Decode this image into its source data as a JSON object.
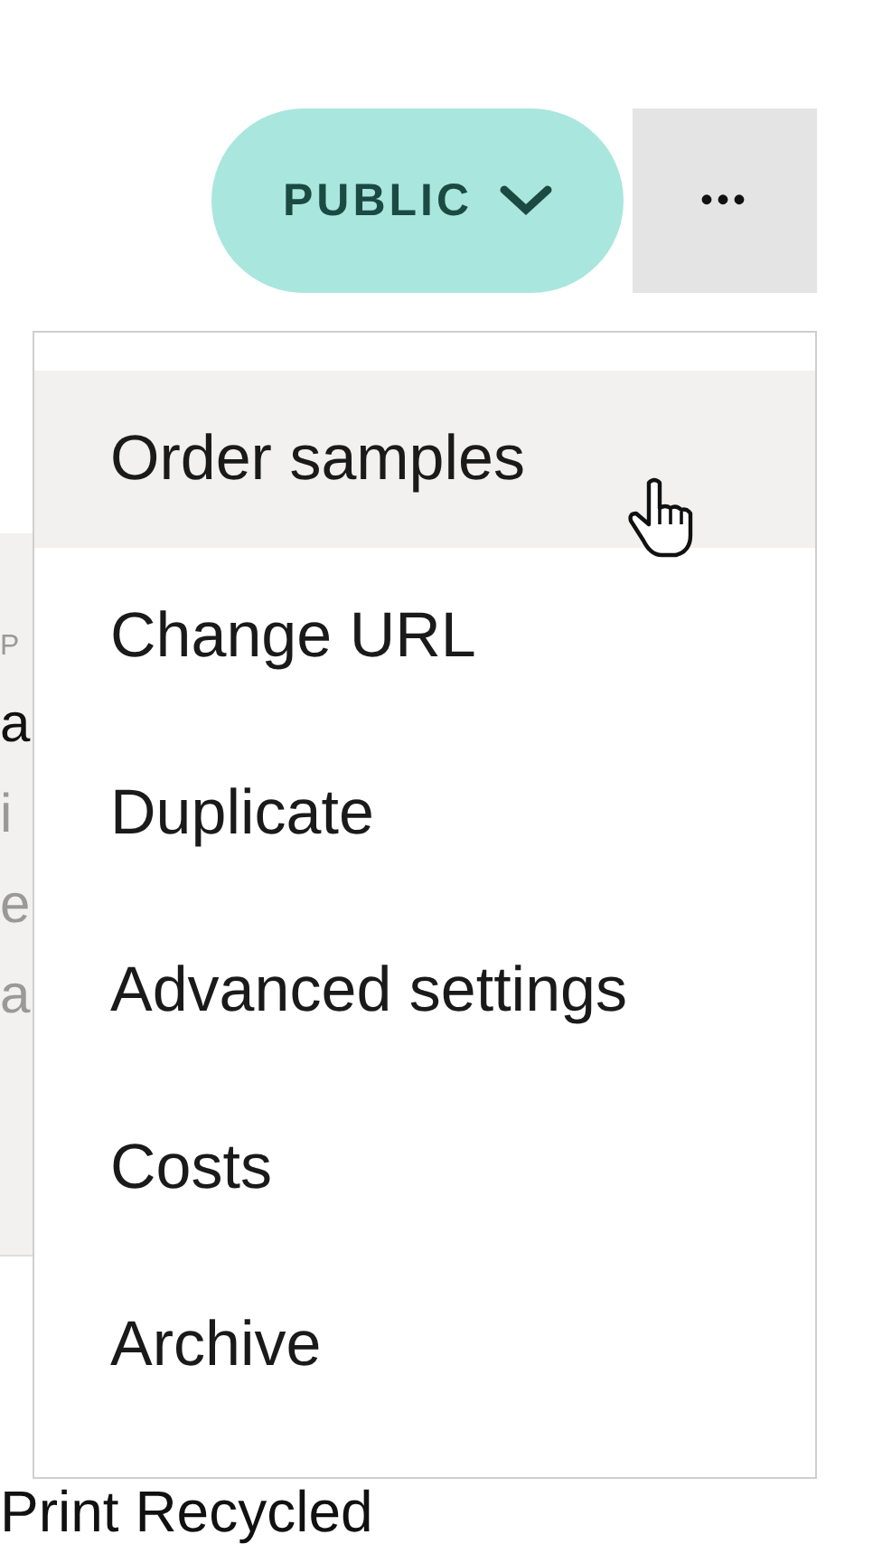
{
  "header": {
    "visibility_button": {
      "label": "PUBLIC"
    },
    "more_button": {
      "label": "•••"
    }
  },
  "background": {
    "card_fragments": [
      {
        "text": "P",
        "kind": "caption"
      },
      {
        "text": "a",
        "kind": "title"
      },
      {
        "text": "i",
        "kind": "body"
      },
      {
        "text": "e",
        "kind": "body"
      },
      {
        "text": "a",
        "kind": "body"
      }
    ],
    "next_title": "Print Recycled"
  },
  "menu": {
    "items": [
      {
        "label": "Order samples",
        "selected": true
      },
      {
        "label": "Change URL",
        "selected": false
      },
      {
        "label": "Duplicate",
        "selected": false
      },
      {
        "label": "Advanced settings",
        "selected": false
      },
      {
        "label": "Costs",
        "selected": false
      },
      {
        "label": "Archive",
        "selected": false
      }
    ]
  }
}
